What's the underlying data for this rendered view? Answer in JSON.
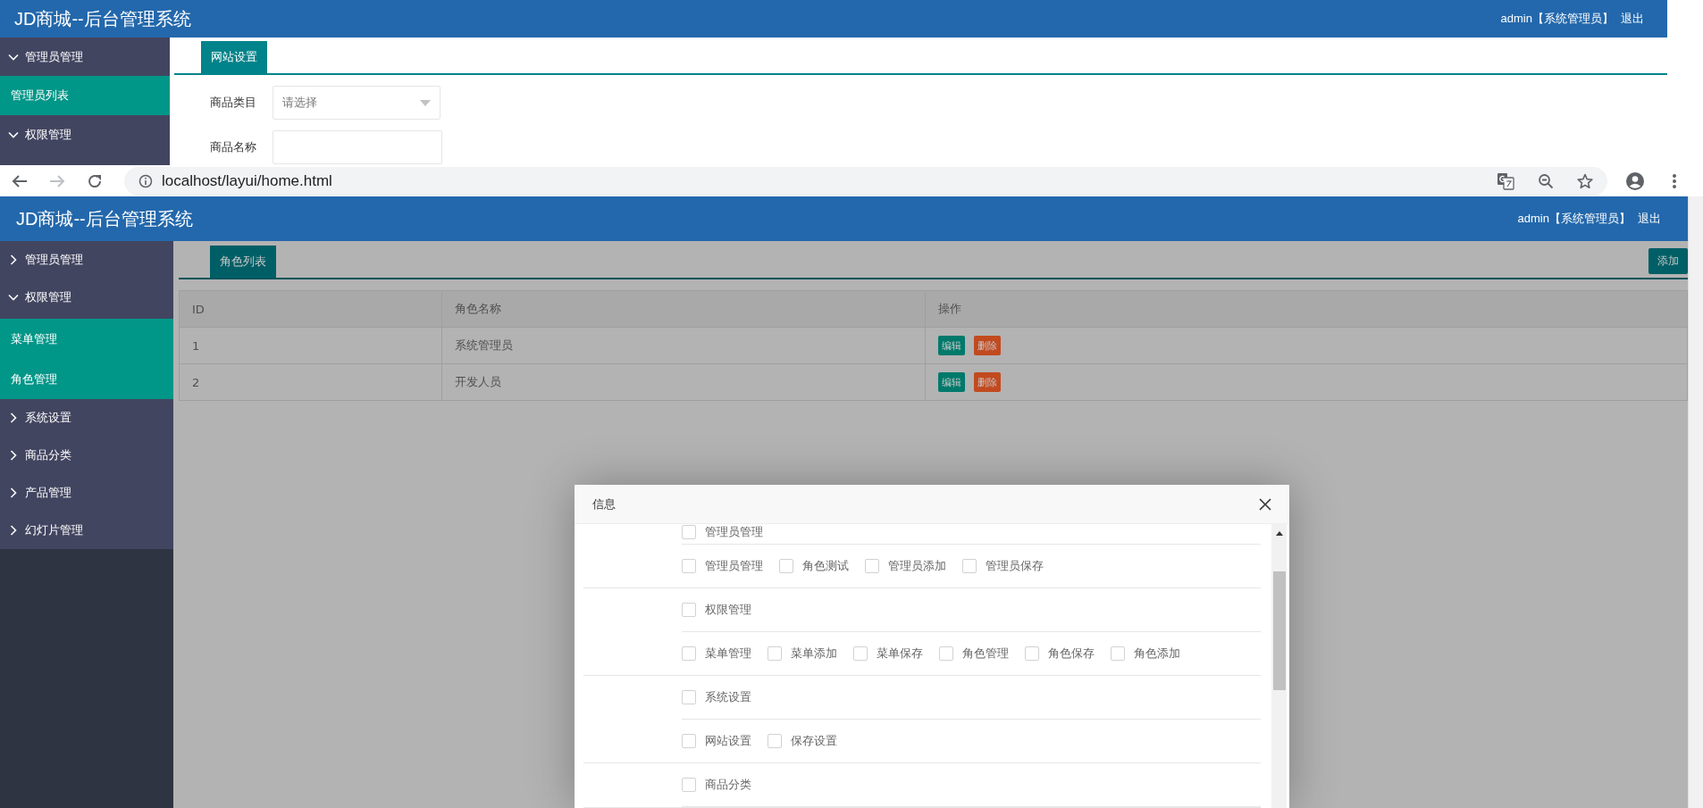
{
  "top_page": {
    "header": {
      "title": "JD商城--后台管理系统",
      "user": "admin【系统管理员】",
      "logout": "退出"
    },
    "sidebar": [
      {
        "label": "管理员管理",
        "expanded": true,
        "children": [
          {
            "label": "管理员列表"
          }
        ]
      },
      {
        "label": "权限管理",
        "expanded": true
      }
    ],
    "tabs": [
      {
        "label": "网站设置",
        "selected": true
      }
    ],
    "form": [
      {
        "label": "商品类目",
        "kind": "select",
        "placeholder": "请选择"
      },
      {
        "label": "商品名称",
        "kind": "text"
      }
    ]
  },
  "browser": {
    "url": "localhost/layui/home.html",
    "forward_disabled": true
  },
  "page": {
    "header": {
      "title": "JD商城--后台管理系统",
      "user": "admin【系统管理员】",
      "logout": "退出"
    },
    "sidebar": [
      {
        "label": "管理员管理",
        "expanded": false
      },
      {
        "label": "权限管理",
        "expanded": true,
        "children": [
          {
            "label": "菜单管理"
          },
          {
            "label": "角色管理"
          }
        ]
      },
      {
        "label": "系统设置",
        "expanded": false
      },
      {
        "label": "商品分类",
        "expanded": false
      },
      {
        "label": "产品管理",
        "expanded": false
      },
      {
        "label": "幻灯片管理",
        "expanded": false
      }
    ],
    "tabs": [
      {
        "label": "角色列表",
        "selected": true
      }
    ],
    "add_button": "添加",
    "table": {
      "columns": [
        "ID",
        "角色名称",
        "操作"
      ],
      "rows": [
        {
          "id": "1",
          "name": "系统管理员",
          "actions": [
            {
              "label": "编辑",
              "kind": "edit"
            },
            {
              "label": "删除",
              "kind": "delete"
            }
          ]
        },
        {
          "id": "2",
          "name": "开发人员",
          "actions": [
            {
              "label": "编辑",
              "kind": "edit"
            },
            {
              "label": "删除",
              "kind": "delete"
            }
          ]
        }
      ]
    }
  },
  "dialog": {
    "title": "信息",
    "groups": [
      {
        "parent": {
          "label": "管理员管理",
          "checked": false
        },
        "children": [
          {
            "label": "管理员管理",
            "checked": false
          },
          {
            "label": "角色测试",
            "checked": false
          },
          {
            "label": "管理员添加",
            "checked": false
          },
          {
            "label": "管理员保存",
            "checked": false
          }
        ]
      },
      {
        "parent": {
          "label": "权限管理",
          "checked": false
        },
        "children": [
          {
            "label": "菜单管理",
            "checked": false
          },
          {
            "label": "菜单添加",
            "checked": false
          },
          {
            "label": "菜单保存",
            "checked": false
          },
          {
            "label": "角色管理",
            "checked": false
          },
          {
            "label": "角色保存",
            "checked": false
          },
          {
            "label": "角色添加",
            "checked": false
          }
        ]
      },
      {
        "parent": {
          "label": "系统设置",
          "checked": false
        },
        "children": [
          {
            "label": "网站设置",
            "checked": false
          },
          {
            "label": "保存设置",
            "checked": false
          }
        ]
      },
      {
        "parent": {
          "label": "商品分类",
          "checked": false
        }
      }
    ]
  }
}
